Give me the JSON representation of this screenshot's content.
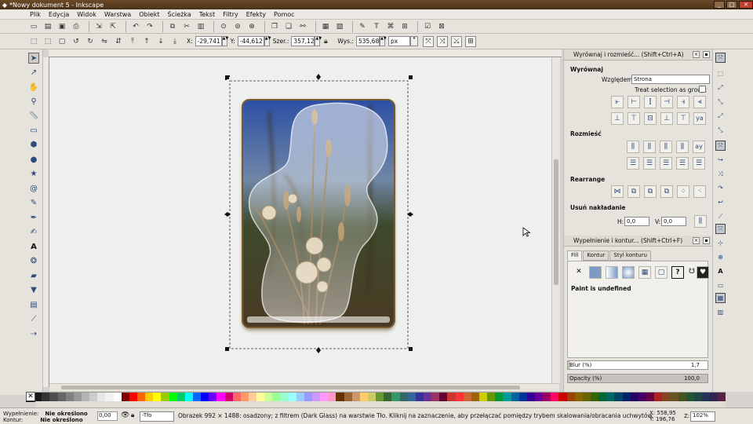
{
  "window": {
    "title": "*Nowy dokument 5 - Inkscape",
    "controls": [
      "_",
      "□",
      "✕"
    ]
  },
  "menu": [
    "Plik",
    "Edycja",
    "Widok",
    "Warstwa",
    "Obiekt",
    "Ścieżka",
    "Tekst",
    "Filtry",
    "Efekty",
    "Pomoc"
  ],
  "toolbar": {
    "x_label": "X:",
    "x_value": "-29,741",
    "y_label": "Y:",
    "y_value": "-44,612",
    "w_label": "Szer.:",
    "w_value": "357,120",
    "h_label": "Wys.:",
    "h_value": "535,680",
    "unit": "px"
  },
  "align_panel": {
    "title": "Wyrównaj i rozmieść... (Shift+Ctrl+A)",
    "section_align": "Wyrównaj",
    "relative_label": "Względem:",
    "relative_value": "Strona",
    "group_label": "Treat selection as group:",
    "section_distribute": "Rozmieść",
    "section_rearrange": "Rearrange",
    "section_overlap": "Usuń nakładanie",
    "h_label": "H:",
    "h_value": "0,0",
    "v_label": "V:",
    "v_value": "0,0"
  },
  "fill_panel": {
    "title": "Wypełnienie i kontur... (Shift+Ctrl+F)",
    "tabs": [
      "Fill",
      "Kontur",
      "Styl konturu"
    ],
    "paint_status": "Paint is undefined",
    "blur_label": "Blur (%)",
    "blur_value": "1,7",
    "blur_level": 0.017,
    "opacity_label": "Opacity (%)",
    "opacity_value": "100,0",
    "opacity_level": 1.0
  },
  "status": {
    "fill_label": "Wypełnienie:",
    "fill_value": "Nie określono",
    "stroke_label": "Kontur:",
    "stroke_value": "Nie określono",
    "opacity_value": "0,00",
    "layer": "-Tło",
    "message": "Obrazek 992 × 1488: osadzony; z filtrem (Dark Glass) na warstwie Tło. Kliknij na zaznaczenie, aby przełączać pomiędzy trybem skalowania/obracania uchwytów.",
    "x_label": "X:",
    "x_value": "558,95",
    "y_label": "Y:",
    "y_value": "196,76",
    "zoom_label": "Z:",
    "zoom_value": "102%"
  },
  "palette_colors": [
    "#000000",
    "#1a1a1a",
    "#333333",
    "#4d4d4d",
    "#666666",
    "#808080",
    "#999999",
    "#b3b3b3",
    "#cccccc",
    "#e6e6e6",
    "#f2f2f2",
    "#ffffff",
    "#800000",
    "#ff0000",
    "#ff6600",
    "#ffcc00",
    "#ffff00",
    "#99cc00",
    "#00ff00",
    "#00cc66",
    "#00ffff",
    "#0066ff",
    "#0000ff",
    "#6600ff",
    "#ff00ff",
    "#cc0066",
    "#ff6666",
    "#ff9966",
    "#ffcc99",
    "#ffff99",
    "#ccff99",
    "#99ff99",
    "#99ffcc",
    "#99ffff",
    "#99ccff",
    "#9999ff",
    "#cc99ff",
    "#ff99ff",
    "#ff99cc",
    "#663300",
    "#996633",
    "#cc9966",
    "#ffcc66",
    "#cccc66",
    "#669933",
    "#336633",
    "#339966",
    "#336666",
    "#336699",
    "#333399",
    "#663399",
    "#993366",
    "#660033",
    "#cc3333",
    "#ff3333",
    "#cc6633",
    "#996600",
    "#cccc00",
    "#669900",
    "#009933",
    "#009999",
    "#006699",
    "#003399",
    "#330099",
    "#660099",
    "#990066",
    "#ff0066",
    "#cc0000",
    "#994400",
    "#886600",
    "#666600",
    "#336600",
    "#006633",
    "#006666",
    "#004466",
    "#002266",
    "#220066",
    "#440066",
    "#660044",
    "#aa2222",
    "#884422",
    "#665522",
    "#445522",
    "#225533",
    "#224444",
    "#223355",
    "#332255",
    "#552244"
  ]
}
